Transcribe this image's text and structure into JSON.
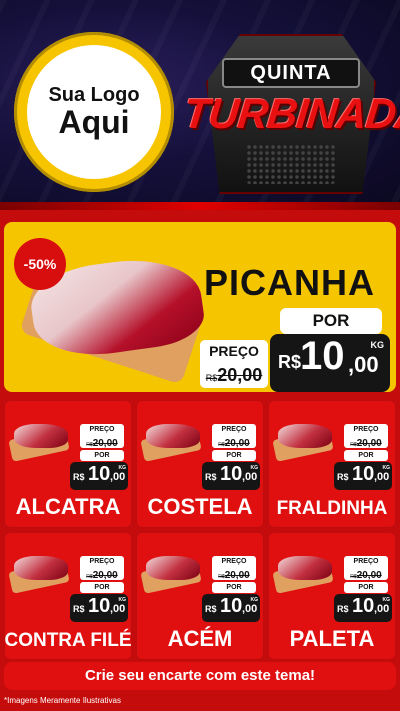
{
  "header": {
    "logo_line1": "Sua Logo",
    "logo_line2": "Aqui",
    "badge_top": "QUINTA",
    "badge_main": "TURBINADA"
  },
  "hero": {
    "discount": "-50%",
    "name": "PICANHA",
    "por_label": "POR",
    "preco_label": "PREÇO",
    "old_currency": "R$",
    "old_value": "20,00",
    "new_currency": "R$",
    "new_int": "10",
    "new_dec": ",00",
    "unit": "KG"
  },
  "cards": [
    {
      "name": "ALCATRA",
      "preco_label": "PREÇO",
      "old_currency": "R$",
      "old_value": "20,00",
      "por_label": "POR",
      "new_currency": "R$",
      "new_int": "10",
      "new_dec": ",00",
      "unit": "KG"
    },
    {
      "name": "COSTELA",
      "preco_label": "PREÇO",
      "old_currency": "R$",
      "old_value": "20,00",
      "por_label": "POR",
      "new_currency": "R$",
      "new_int": "10",
      "new_dec": ",00",
      "unit": "KG"
    },
    {
      "name": "FRALDINHA",
      "preco_label": "PREÇO",
      "old_currency": "R$",
      "old_value": "20,00",
      "por_label": "POR",
      "new_currency": "R$",
      "new_int": "10",
      "new_dec": ",00",
      "unit": "KG"
    },
    {
      "name": "CONTRA FILÉ",
      "preco_label": "PREÇO",
      "old_currency": "R$",
      "old_value": "20,00",
      "por_label": "POR",
      "new_currency": "R$",
      "new_int": "10",
      "new_dec": ",00",
      "unit": "KG"
    },
    {
      "name": "ACÉM",
      "preco_label": "PREÇO",
      "old_currency": "R$",
      "old_value": "20,00",
      "por_label": "POR",
      "new_currency": "R$",
      "new_int": "10",
      "new_dec": ",00",
      "unit": "KG"
    },
    {
      "name": "PALETA",
      "preco_label": "PREÇO",
      "old_currency": "R$",
      "old_value": "20,00",
      "por_label": "POR",
      "new_currency": "R$",
      "new_int": "10",
      "new_dec": ",00",
      "unit": "KG"
    }
  ],
  "cta": "Crie seu encarte com este tema!",
  "footnote": "*Imagens Meramente Ilustrativas",
  "colors": {
    "primary_red": "#e01010",
    "hero_yellow": "#f5c500",
    "logo_yellow": "#f7c400",
    "header_bg": "#14103a"
  }
}
